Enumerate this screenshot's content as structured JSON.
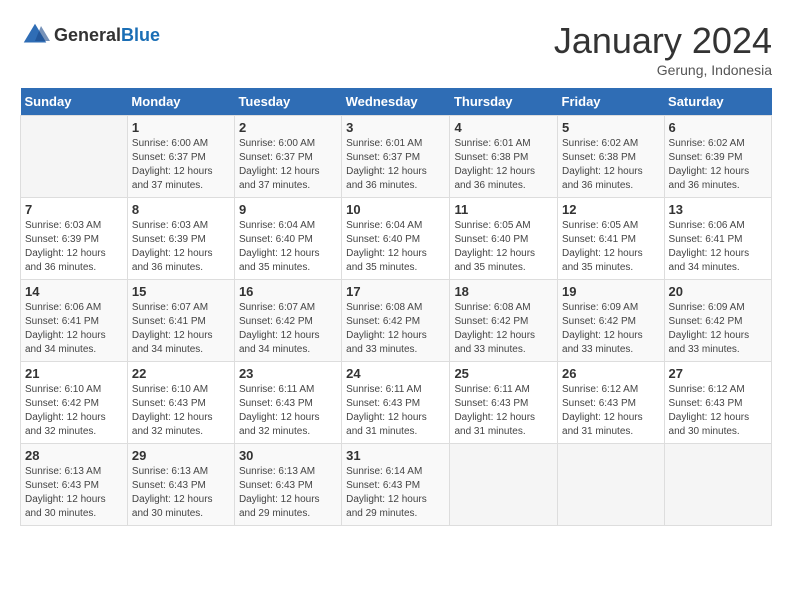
{
  "header": {
    "logo_general": "General",
    "logo_blue": "Blue",
    "month": "January 2024",
    "location": "Gerung, Indonesia"
  },
  "weekdays": [
    "Sunday",
    "Monday",
    "Tuesday",
    "Wednesday",
    "Thursday",
    "Friday",
    "Saturday"
  ],
  "weeks": [
    [
      {
        "day": "",
        "sunrise": "",
        "sunset": "",
        "daylight": ""
      },
      {
        "day": "1",
        "sunrise": "Sunrise: 6:00 AM",
        "sunset": "Sunset: 6:37 PM",
        "daylight": "Daylight: 12 hours and 37 minutes."
      },
      {
        "day": "2",
        "sunrise": "Sunrise: 6:00 AM",
        "sunset": "Sunset: 6:37 PM",
        "daylight": "Daylight: 12 hours and 37 minutes."
      },
      {
        "day": "3",
        "sunrise": "Sunrise: 6:01 AM",
        "sunset": "Sunset: 6:37 PM",
        "daylight": "Daylight: 12 hours and 36 minutes."
      },
      {
        "day": "4",
        "sunrise": "Sunrise: 6:01 AM",
        "sunset": "Sunset: 6:38 PM",
        "daylight": "Daylight: 12 hours and 36 minutes."
      },
      {
        "day": "5",
        "sunrise": "Sunrise: 6:02 AM",
        "sunset": "Sunset: 6:38 PM",
        "daylight": "Daylight: 12 hours and 36 minutes."
      },
      {
        "day": "6",
        "sunrise": "Sunrise: 6:02 AM",
        "sunset": "Sunset: 6:39 PM",
        "daylight": "Daylight: 12 hours and 36 minutes."
      }
    ],
    [
      {
        "day": "7",
        "sunrise": "Sunrise: 6:03 AM",
        "sunset": "Sunset: 6:39 PM",
        "daylight": "Daylight: 12 hours and 36 minutes."
      },
      {
        "day": "8",
        "sunrise": "Sunrise: 6:03 AM",
        "sunset": "Sunset: 6:39 PM",
        "daylight": "Daylight: 12 hours and 36 minutes."
      },
      {
        "day": "9",
        "sunrise": "Sunrise: 6:04 AM",
        "sunset": "Sunset: 6:40 PM",
        "daylight": "Daylight: 12 hours and 35 minutes."
      },
      {
        "day": "10",
        "sunrise": "Sunrise: 6:04 AM",
        "sunset": "Sunset: 6:40 PM",
        "daylight": "Daylight: 12 hours and 35 minutes."
      },
      {
        "day": "11",
        "sunrise": "Sunrise: 6:05 AM",
        "sunset": "Sunset: 6:40 PM",
        "daylight": "Daylight: 12 hours and 35 minutes."
      },
      {
        "day": "12",
        "sunrise": "Sunrise: 6:05 AM",
        "sunset": "Sunset: 6:41 PM",
        "daylight": "Daylight: 12 hours and 35 minutes."
      },
      {
        "day": "13",
        "sunrise": "Sunrise: 6:06 AM",
        "sunset": "Sunset: 6:41 PM",
        "daylight": "Daylight: 12 hours and 34 minutes."
      }
    ],
    [
      {
        "day": "14",
        "sunrise": "Sunrise: 6:06 AM",
        "sunset": "Sunset: 6:41 PM",
        "daylight": "Daylight: 12 hours and 34 minutes."
      },
      {
        "day": "15",
        "sunrise": "Sunrise: 6:07 AM",
        "sunset": "Sunset: 6:41 PM",
        "daylight": "Daylight: 12 hours and 34 minutes."
      },
      {
        "day": "16",
        "sunrise": "Sunrise: 6:07 AM",
        "sunset": "Sunset: 6:42 PM",
        "daylight": "Daylight: 12 hours and 34 minutes."
      },
      {
        "day": "17",
        "sunrise": "Sunrise: 6:08 AM",
        "sunset": "Sunset: 6:42 PM",
        "daylight": "Daylight: 12 hours and 33 minutes."
      },
      {
        "day": "18",
        "sunrise": "Sunrise: 6:08 AM",
        "sunset": "Sunset: 6:42 PM",
        "daylight": "Daylight: 12 hours and 33 minutes."
      },
      {
        "day": "19",
        "sunrise": "Sunrise: 6:09 AM",
        "sunset": "Sunset: 6:42 PM",
        "daylight": "Daylight: 12 hours and 33 minutes."
      },
      {
        "day": "20",
        "sunrise": "Sunrise: 6:09 AM",
        "sunset": "Sunset: 6:42 PM",
        "daylight": "Daylight: 12 hours and 33 minutes."
      }
    ],
    [
      {
        "day": "21",
        "sunrise": "Sunrise: 6:10 AM",
        "sunset": "Sunset: 6:42 PM",
        "daylight": "Daylight: 12 hours and 32 minutes."
      },
      {
        "day": "22",
        "sunrise": "Sunrise: 6:10 AM",
        "sunset": "Sunset: 6:43 PM",
        "daylight": "Daylight: 12 hours and 32 minutes."
      },
      {
        "day": "23",
        "sunrise": "Sunrise: 6:11 AM",
        "sunset": "Sunset: 6:43 PM",
        "daylight": "Daylight: 12 hours and 32 minutes."
      },
      {
        "day": "24",
        "sunrise": "Sunrise: 6:11 AM",
        "sunset": "Sunset: 6:43 PM",
        "daylight": "Daylight: 12 hours and 31 minutes."
      },
      {
        "day": "25",
        "sunrise": "Sunrise: 6:11 AM",
        "sunset": "Sunset: 6:43 PM",
        "daylight": "Daylight: 12 hours and 31 minutes."
      },
      {
        "day": "26",
        "sunrise": "Sunrise: 6:12 AM",
        "sunset": "Sunset: 6:43 PM",
        "daylight": "Daylight: 12 hours and 31 minutes."
      },
      {
        "day": "27",
        "sunrise": "Sunrise: 6:12 AM",
        "sunset": "Sunset: 6:43 PM",
        "daylight": "Daylight: 12 hours and 30 minutes."
      }
    ],
    [
      {
        "day": "28",
        "sunrise": "Sunrise: 6:13 AM",
        "sunset": "Sunset: 6:43 PM",
        "daylight": "Daylight: 12 hours and 30 minutes."
      },
      {
        "day": "29",
        "sunrise": "Sunrise: 6:13 AM",
        "sunset": "Sunset: 6:43 PM",
        "daylight": "Daylight: 12 hours and 30 minutes."
      },
      {
        "day": "30",
        "sunrise": "Sunrise: 6:13 AM",
        "sunset": "Sunset: 6:43 PM",
        "daylight": "Daylight: 12 hours and 29 minutes."
      },
      {
        "day": "31",
        "sunrise": "Sunrise: 6:14 AM",
        "sunset": "Sunset: 6:43 PM",
        "daylight": "Daylight: 12 hours and 29 minutes."
      },
      {
        "day": "",
        "sunrise": "",
        "sunset": "",
        "daylight": ""
      },
      {
        "day": "",
        "sunrise": "",
        "sunset": "",
        "daylight": ""
      },
      {
        "day": "",
        "sunrise": "",
        "sunset": "",
        "daylight": ""
      }
    ]
  ]
}
